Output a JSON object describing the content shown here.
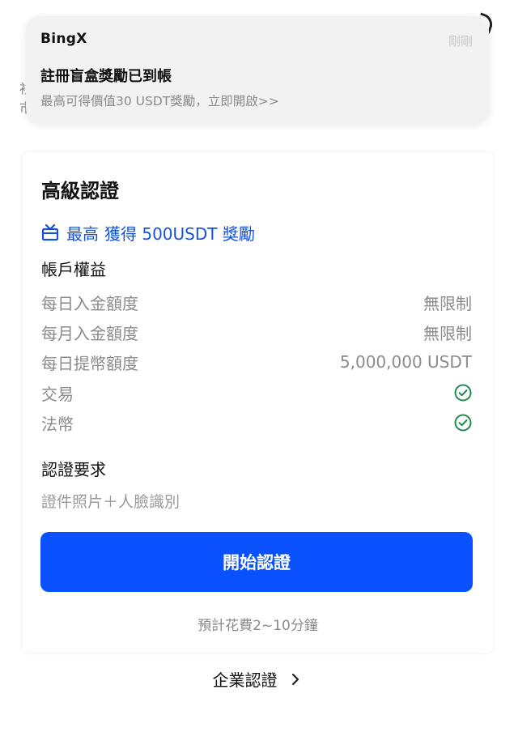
{
  "notification": {
    "app": "BingX",
    "time": "剛剛",
    "title": "註冊盲盒獎勵已到帳",
    "body": "最高可得價值30 USDT獎勵，立即開啟>>"
  },
  "card": {
    "title": "高級認證",
    "reward": {
      "prefix": "最高",
      "text": "獲得 500USDT 獎勵",
      "icon": "gift-icon",
      "color": "#1652d9"
    },
    "benefits_title": "帳戶權益",
    "benefits": [
      {
        "label": "每日入金額度",
        "value": "無限制"
      },
      {
        "label": "每月入金額度",
        "value": "無限制"
      },
      {
        "label": "每日提幣額度",
        "value": "5,000,000 USDT"
      },
      {
        "label": "交易",
        "icon": "check-circle-icon"
      },
      {
        "label": "法幣",
        "icon": "check-circle-icon"
      }
    ],
    "requirements_title": "認證要求",
    "requirements_text": "證件照片＋人臉識別",
    "button_label": "開始認證",
    "button_color": "#0a52ff",
    "estimate": "預計花費2~10分鐘"
  },
  "enterprise_link": "企業認證",
  "colors": {
    "check": "#1e8a4e"
  }
}
